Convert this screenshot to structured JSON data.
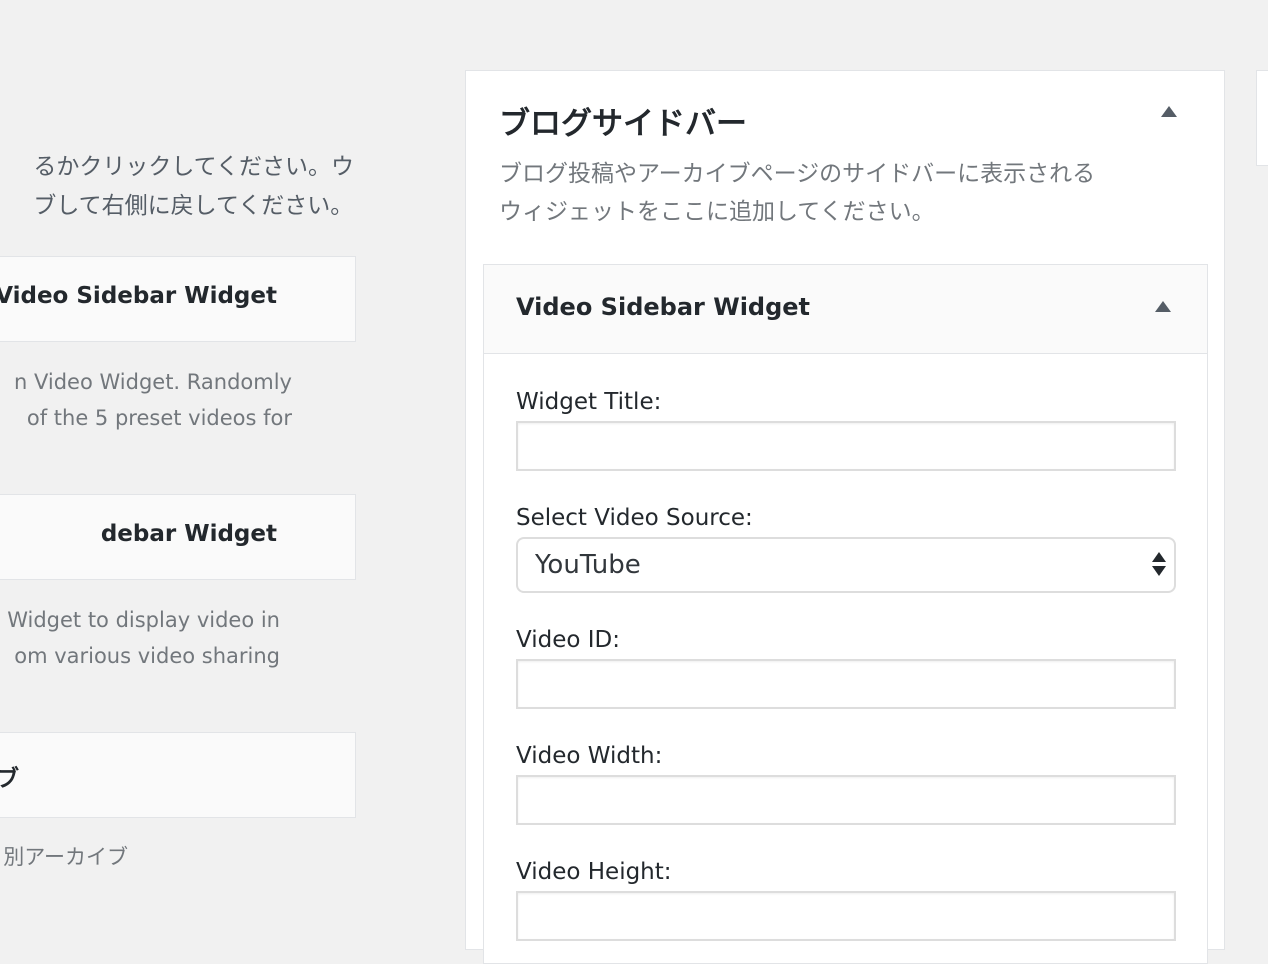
{
  "available_widgets": {
    "intro_lines": [
      "るかクリックしてください。ウ",
      "ブして右側に戻してください。"
    ],
    "items": [
      {
        "title": "Video Sidebar Widget",
        "desc_lines": [
          "n Video Widget. Randomly",
          "of the 5 preset videos for"
        ]
      },
      {
        "title": "debar Widget",
        "desc_lines": [
          "Widget to display video in",
          "om various video sharing"
        ]
      },
      {
        "title": "ブ",
        "desc_lines": [
          "別アーカイブ"
        ]
      }
    ]
  },
  "sidebar": {
    "title": "ブログサイドバー",
    "desc_lines": [
      "ブログ投稿やアーカイブページのサイドバーに表示される",
      "ウィジェットをここに追加してください。"
    ],
    "widget": {
      "title": "Video Sidebar Widget",
      "fields": {
        "widget_title": {
          "label": "Widget Title:",
          "value": ""
        },
        "video_source": {
          "label": "Select Video Source:",
          "value": "YouTube"
        },
        "video_id": {
          "label": "Video ID:",
          "value": ""
        },
        "video_width": {
          "label": "Video Width:",
          "value": ""
        },
        "video_height": {
          "label": "Video Height:",
          "value": ""
        }
      }
    }
  },
  "colors": {
    "background": "#f1f1f1",
    "panel": "#ffffff",
    "border": "#e2e4e7",
    "header_bg": "#fafafa",
    "text": "#23282d",
    "muted_text": "#72777c"
  },
  "icons": {
    "collapse": "triangle-up-icon",
    "select": "select-arrows-icon"
  }
}
